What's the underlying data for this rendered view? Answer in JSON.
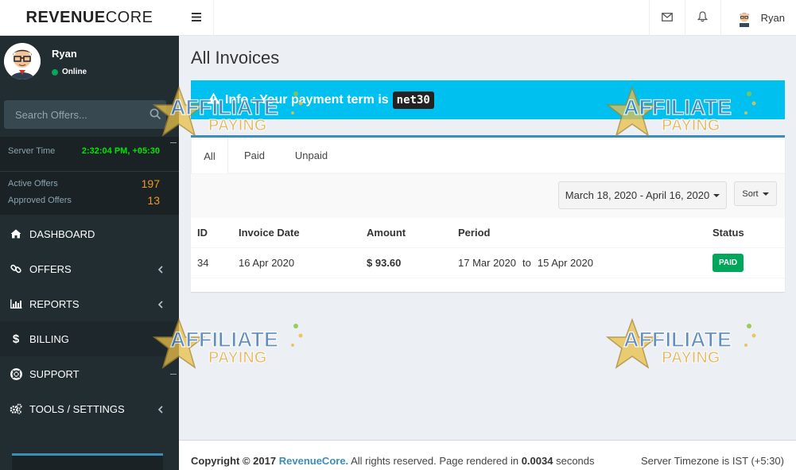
{
  "brand": {
    "name_bold": "REVENUE",
    "name_rest": "CORE"
  },
  "header": {
    "user_name": "Ryan"
  },
  "sidebar": {
    "user": {
      "name": "Ryan",
      "status": "Online"
    },
    "search_placeholder": "Search Offers...",
    "stats": {
      "server_time_label": "Server Time",
      "server_time_value": "2:32:04 PM, +05:30",
      "active_offers_label": "Active Offers",
      "active_offers_value": "197",
      "approved_offers_label": "Approved Offers",
      "approved_offers_value": "13"
    },
    "menu": [
      {
        "label": "DASHBOARD"
      },
      {
        "label": "OFFERS"
      },
      {
        "label": "REPORTS"
      },
      {
        "label": "BILLING"
      },
      {
        "label": "SUPPORT"
      },
      {
        "label": "TOOLS / SETTINGS"
      }
    ]
  },
  "page": {
    "title": "All Invoices",
    "alert_text": "Info : Your payment term is",
    "alert_code": "net30"
  },
  "tabs": [
    "All",
    "Paid",
    "Unpaid"
  ],
  "filters": {
    "date_range": "March 18, 2020 - April 16, 2020",
    "sort_label": "Sort"
  },
  "table": {
    "headers": [
      "ID",
      "Invoice Date",
      "Amount",
      "Period",
      "Status"
    ],
    "rows": [
      {
        "id": "34",
        "date": "16 Apr 2020",
        "amount": "$ 93.60",
        "period_from": "17 Mar 2020",
        "period_to_word": "to",
        "period_to": "15 Apr 2020",
        "status": "PAID"
      }
    ]
  },
  "footer": {
    "copyright": "Copyright © 2017",
    "brand": "RevenueCore.",
    "rights": "All rights reserved. Page rendered in",
    "render_time": "0.0034",
    "seconds": "seconds",
    "timezone": "Server Timezone is IST (+5:30)"
  },
  "watermark": {
    "line1": "AFFILIATE",
    "line2": "PAYING"
  },
  "colors": {
    "sidebar": "#222d32",
    "accent": "#3c8dbc",
    "alert": "#00c0ef",
    "paid": "#00a65a",
    "stat_number": "#f39c12",
    "time": "#00e400"
  }
}
